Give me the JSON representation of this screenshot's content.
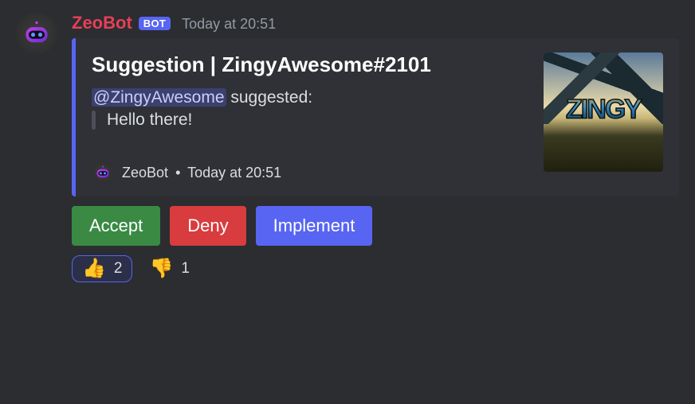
{
  "author": {
    "name": "ZeoBot",
    "tag": "BOT",
    "timestamp": "Today at 20:51"
  },
  "embed": {
    "title": "Suggestion | ZingyAwesome#2101",
    "mention": "@ZingyAwesome",
    "suggested_label": " suggested:",
    "quote": "Hello there!",
    "footer_name": "ZeoBot",
    "footer_sep": "•",
    "footer_time": "Today at 20:51",
    "thumb_text": "ZINGY"
  },
  "buttons": {
    "accept": "Accept",
    "deny": "Deny",
    "implement": "Implement"
  },
  "reactions": {
    "up_emoji": "👍",
    "up_count": "2",
    "down_emoji": "👎",
    "down_count": "1"
  }
}
